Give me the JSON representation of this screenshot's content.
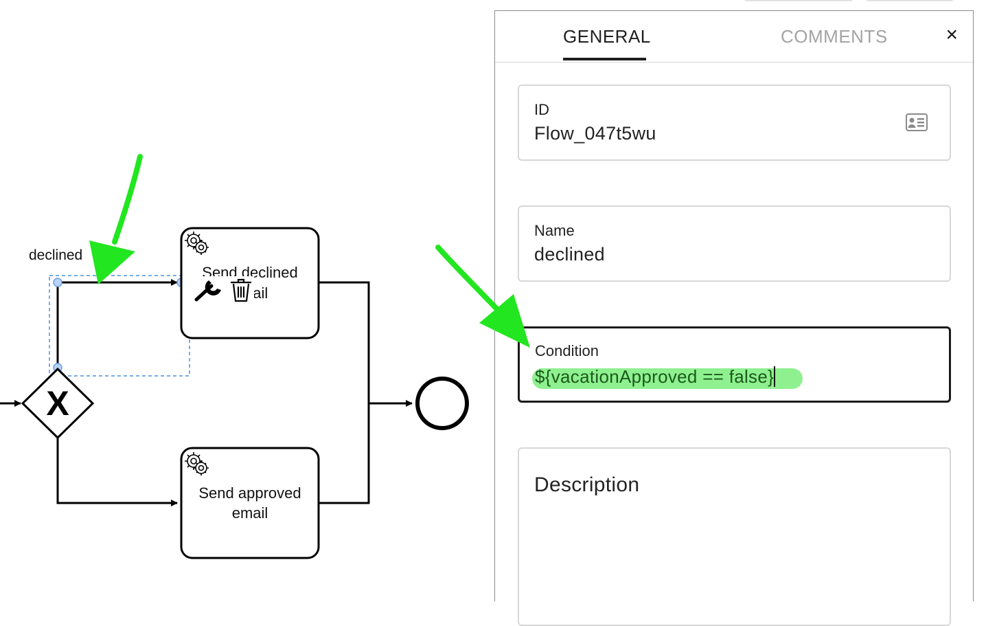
{
  "diagram": {
    "flow_label": "declined",
    "tasks": [
      {
        "name_line1": "Send declined",
        "name_line2": "email",
        "icon": "gear-icon"
      },
      {
        "name_line1": "Send approved",
        "name_line2": "email",
        "icon": "gear-icon"
      }
    ],
    "gateway_symbol": "X",
    "context_icons": [
      "wrench-icon",
      "trash-icon"
    ],
    "annotation_color": "#22e61f"
  },
  "panel": {
    "tabs": [
      {
        "label": "GENERAL",
        "active": true
      },
      {
        "label": "COMMENTS",
        "active": false
      }
    ],
    "close_label": "×",
    "fields": {
      "id": {
        "label": "ID",
        "value": "Flow_047t5wu",
        "icon": "id-card-icon"
      },
      "name": {
        "label": "Name",
        "value": "declined"
      },
      "condition": {
        "label": "Condition",
        "value": "${vacationApproved == false}"
      },
      "description": {
        "label": "Description",
        "value": ""
      }
    }
  }
}
